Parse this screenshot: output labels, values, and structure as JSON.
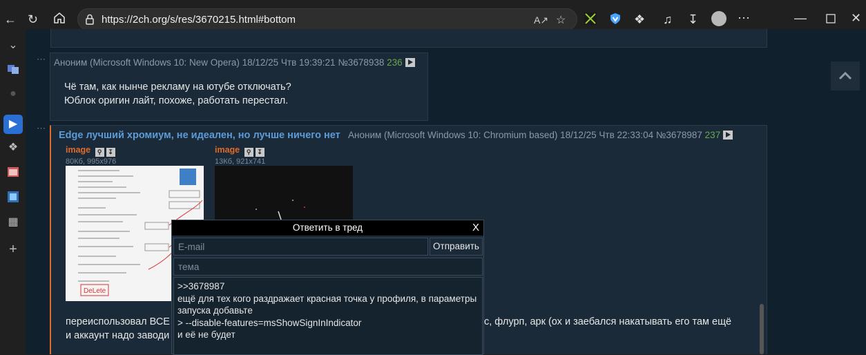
{
  "browser": {
    "url": "https://2ch.org/s/res/3670215.html#bottom"
  },
  "post1": {
    "name": "Аноним",
    "ua": "(Microsoft Windows 10: New Opera)",
    "date": "18/12/25 Чтв 19:39:21",
    "num": "№3678938",
    "count": "236",
    "lines": [
      "Чё там, как нынче рекламу на ютубе отключать?",
      "Юблок оригин лайт, похоже, работать перестал."
    ]
  },
  "post2": {
    "subject": "Edge лучший хромиум, не идеален, но лучше ничего нет",
    "name": "Аноним",
    "ua": "(Microsoft Windows 10: Chromium based)",
    "date": "18/12/25 Чтв 22:33:04",
    "num": "№3678987",
    "count": "237",
    "images": [
      {
        "label": "image",
        "info": "80Кб, 995x976"
      },
      {
        "label": "image",
        "info": "13Кб, 921x741"
      }
    ],
    "line1_start": "переиспользовал ВСЕ",
    "line1_end": "с, флурп, арк (ох и заебался накатывать его там ещё",
    "line2_start": "и аккаунт надо заводи"
  },
  "reply": {
    "title": "Ответить в тред",
    "close": "X",
    "email_placeholder": "E-mail",
    "subject_placeholder": "тема",
    "send": "Отправить",
    "message": ">>3678987\nещё для тех кого раздражает красная точка у профиля, в параметры запуска добавьте\n> --disable-features=msShowSignInIndicator\nи её не будет"
  },
  "colors": {
    "accent_link": "#5d9bd6",
    "image_label": "#e06a2a",
    "count": "#6aa84f"
  }
}
